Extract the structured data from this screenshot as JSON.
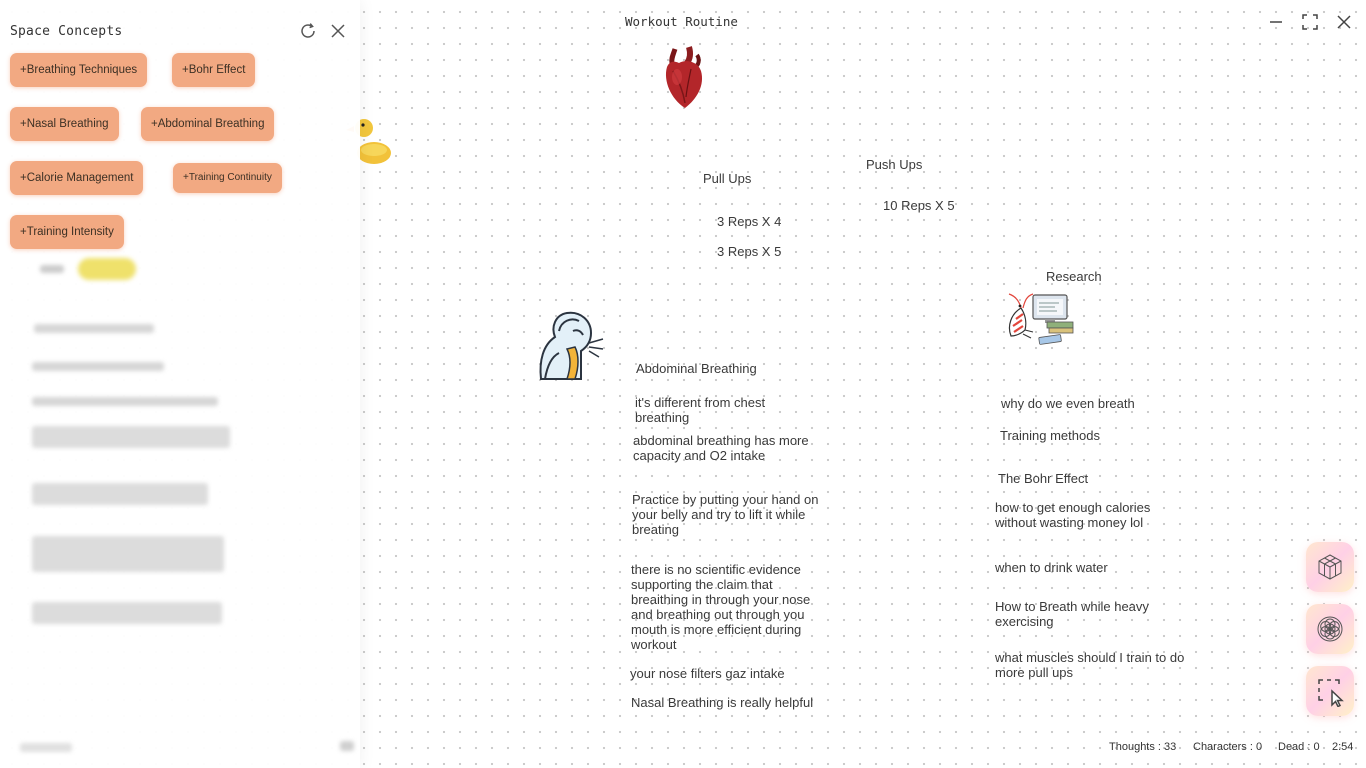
{
  "panel": {
    "title": "Space Concepts",
    "chips": [
      "+Breathing Techniques",
      "+Bohr Effect",
      "+Nasal Breathing",
      "+Abdominal Breathing",
      "+Calorie Management",
      "+Training Continuity",
      "+Training Intensity"
    ]
  },
  "canvas": {
    "title": "Workout Routine",
    "pull_ups": "Pull Ups",
    "push_ups": "Push Ups",
    "pull_reps_1": "3 Reps X 4",
    "pull_reps_2": "3 Reps X 5",
    "push_reps": "10 Reps X 5",
    "research": "Research",
    "abdominal_title": "Abdominal Breathing",
    "abdominal_notes": [
      "it's different from chest breathing",
      "abdominal breathing has more capacity and O2 intake",
      "Practice by putting your hand on your belly and try to lift it while breating",
      "there is no scientific evidence supporting the claim that breaithing in through your nose and breathing out through you mouth is more efficient during workout",
      "your nose filters gaz intake",
      "Nasal Breathing is really helpful"
    ],
    "research_notes": [
      "why do we even breath",
      "Training methods",
      "The Bohr Effect",
      "how to get enough calories without wasting money lol",
      "when to drink water",
      "How to Breath while heavy exercising",
      "what muscles should I train to do more pull ups"
    ]
  },
  "status": {
    "thoughts": "Thoughts : 33",
    "characters": "Characters : 0",
    "dead": "Dead : 0",
    "time": "2:54"
  },
  "icons": {
    "refresh": "refresh-icon",
    "close": "close-icon",
    "minimize": "minimize-icon",
    "maximize": "maximize-icon",
    "window_close": "window-close-icon",
    "cube_tool": "cube-icon",
    "flower_tool": "flower-of-life-icon",
    "select_tool": "selection-cursor-icon"
  },
  "colors": {
    "chip_bg": "#f2a982",
    "panel_bg": "#ffffff"
  }
}
